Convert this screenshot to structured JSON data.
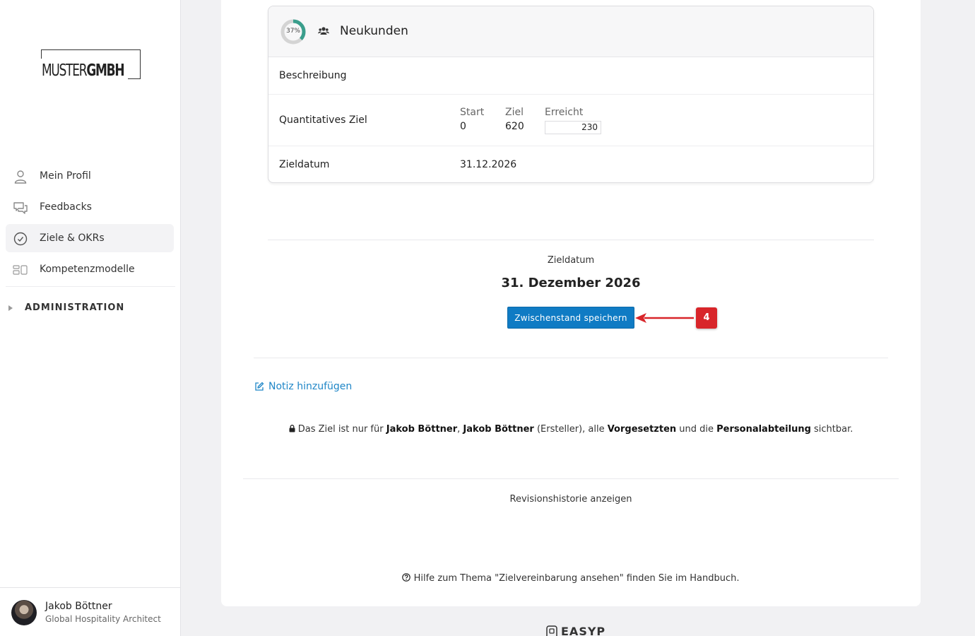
{
  "brand": {
    "logo_light": "MUSTER",
    "logo_bold": "GMBH"
  },
  "sidebar": {
    "items": [
      {
        "label": "Mein Profil",
        "icon": "user-icon"
      },
      {
        "label": "Feedbacks",
        "icon": "chat-icon"
      },
      {
        "label": "Ziele & OKRs",
        "icon": "check-circle-icon",
        "active": true
      },
      {
        "label": "Kompetenzmodelle",
        "icon": "model-icon"
      }
    ],
    "admin_label": "ADMINISTRATION"
  },
  "user": {
    "name": "Jakob Böttner",
    "role": "Global Hospitality Architect"
  },
  "card": {
    "progress_label": "37%",
    "progress": 37,
    "title": "Neukunden",
    "description_label": "Beschreibung",
    "quant_label": "Quantitatives Ziel",
    "start_label": "Start",
    "start_value": "0",
    "target_label": "Ziel",
    "target_value": "620",
    "reached_label": "Erreicht",
    "reached_value": "230",
    "date_label": "Zieldatum",
    "date_value": "31.12.2026"
  },
  "summary": {
    "date_label": "Zieldatum",
    "date_value": "31. Dezember 2026",
    "save_button": "Zwischenstand speichern"
  },
  "annotation": {
    "badge": "4"
  },
  "notes": {
    "add_note": "Notiz hinzufügen",
    "vis_prefix": "Das Ziel ist nur für ",
    "vis_name1": "Jakob Böttner",
    "vis_sep": ", ",
    "vis_name2": "Jakob Böttner",
    "vis_mid": " (Ersteller), alle ",
    "vis_sup": "Vorgesetzten",
    "vis_and": " und die ",
    "vis_hr": "Personalabteilung",
    "vis_suffix": " sichtbar.",
    "revision": "Revisionshistorie anzeigen",
    "help": "Hilfe zum Thema \"Zielvereinbarung ansehen\" finden Sie im Handbuch."
  },
  "footer": {
    "logo": "EASYP"
  },
  "colors": {
    "accent": "#0f7bc4",
    "progress": "#3a9e8c",
    "badge": "#d8252a",
    "link": "#1f86c7"
  }
}
